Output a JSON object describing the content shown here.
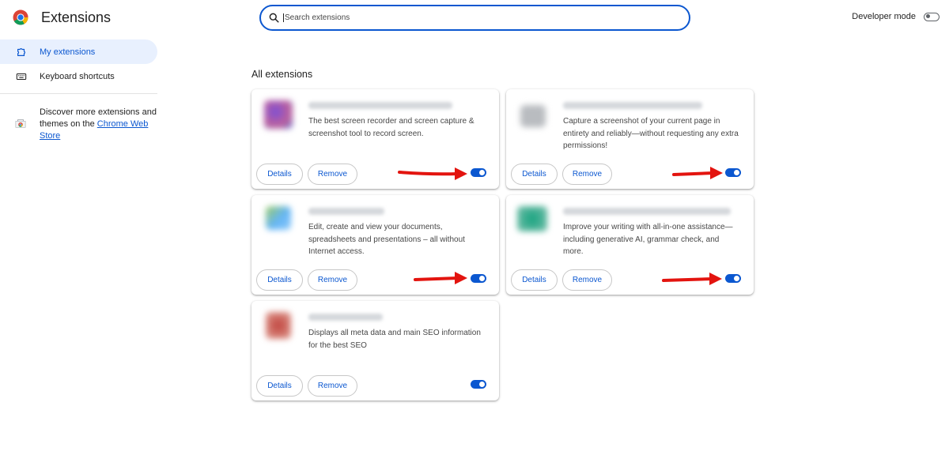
{
  "header": {
    "title": "Extensions",
    "logo_icon": "chrome-logo-icon",
    "search": {
      "placeholder": "Search extensions",
      "value": ""
    },
    "developer_mode": {
      "label": "Developer mode",
      "enabled": false
    }
  },
  "sidebar": {
    "items": [
      {
        "label": "My extensions",
        "icon": "puzzle-piece-icon",
        "active": true
      },
      {
        "label": "Keyboard shortcuts",
        "icon": "keyboard-icon",
        "active": false
      }
    ],
    "discover": {
      "text": "Discover more extensions and themes on the ",
      "link": "Chrome Web Store",
      "icon": "chrome-web-store-icon"
    }
  },
  "main": {
    "section_title": "All extensions",
    "cards": [
      {
        "description": "The best screen recorder and screen capture & screenshot tool to record screen.",
        "details_label": "Details",
        "remove_label": "Remove",
        "enabled": true
      },
      {
        "description": "Capture a screenshot of your current page in entirety and reliably—without requesting any extra permissions!",
        "details_label": "Details",
        "remove_label": "Remove",
        "enabled": true
      },
      {
        "description": "Edit, create and view your documents, spreadsheets and presentations – all without Internet access.",
        "details_label": "Details",
        "remove_label": "Remove",
        "enabled": true
      },
      {
        "description": "Improve your writing with all-in-one assistance—including generative AI, grammar check, and more.",
        "details_label": "Details",
        "remove_label": "Remove",
        "enabled": true
      },
      {
        "description": "Displays all meta data and main SEO information for the best SEO",
        "details_label": "Details",
        "remove_label": "Remove",
        "enabled": true
      }
    ]
  },
  "colors": {
    "accent": "#0b57d0",
    "active_nav_bg": "#e8f0fe",
    "annotation_arrow": "#e3140f"
  }
}
